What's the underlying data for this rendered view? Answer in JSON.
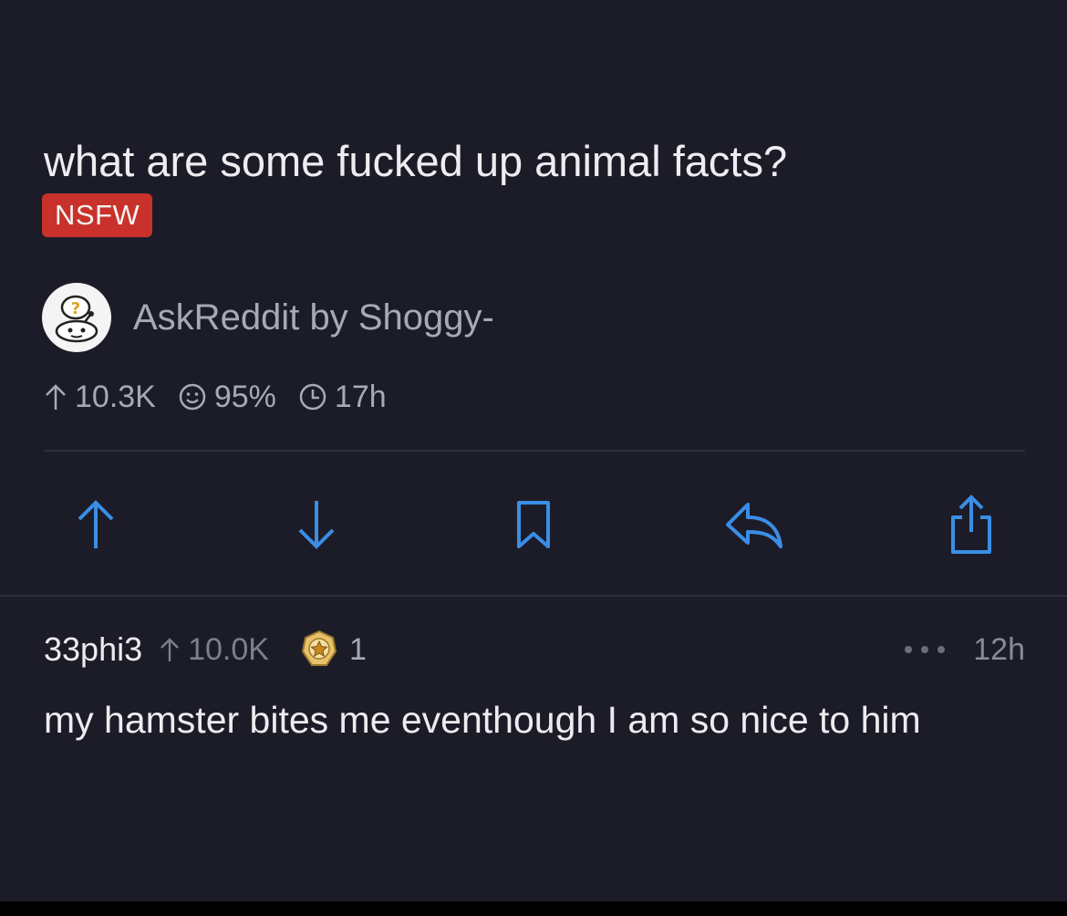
{
  "post": {
    "title": "what are some fucked up animal facts?",
    "nsfw_label": "NSFW",
    "subreddit": "AskReddit",
    "by_word": "by",
    "author": "Shoggy-",
    "upvotes": "10.3K",
    "upvote_ratio": "95%",
    "age": "17h"
  },
  "actions": {
    "icons": [
      "arrow-up-icon",
      "arrow-down-icon",
      "bookmark-icon",
      "reply-icon",
      "share-icon"
    ]
  },
  "comment": {
    "author": "33phi3",
    "score": "10.0K",
    "award_count": "1",
    "age": "12h",
    "body": "my hamster bites me eventhough I am so nice to him"
  },
  "colors": {
    "background": "#1c1c28",
    "accent_blue": "#3a8ee6",
    "nsfw_red": "#c8322a",
    "muted_text": "#a9a9b3"
  }
}
